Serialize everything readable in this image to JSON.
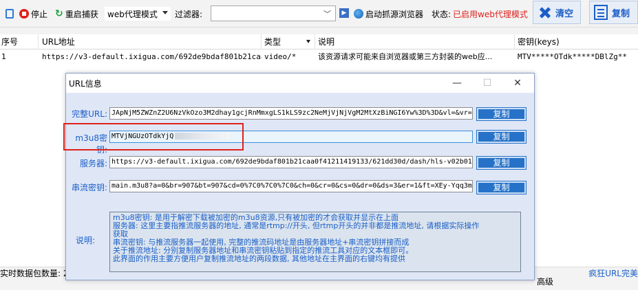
{
  "toolbar": {
    "stop_label": "停止",
    "restart_label": "重启捕获",
    "mode_value": "web代理模式",
    "filter_label": "过滤器:",
    "filter_value": "",
    "launch_label": "启动抓源浏览器",
    "status_label": "状态:",
    "status_value": "已启用web代理模式",
    "clear_label": "清空",
    "copy_label": "复制"
  },
  "grid": {
    "columns": [
      "序号",
      "URL地址",
      "类型",
      "说明",
      "密钥(keys)"
    ],
    "rows": [
      {
        "index": "1",
        "url": "https://v3-default.ixigua.com/692de9bdaf801b21caa...",
        "type": "video/*",
        "desc": "该资源请求可能来自浏览器或第三方封装的web应...",
        "keys": "MTV*****OTdk*****DBlZg**"
      }
    ]
  },
  "statusbar": {
    "packet_label": "实时数据包数量: 2",
    "mid_text": "高级",
    "right_text": "疯狂URL完美"
  },
  "dialog": {
    "title": "URL信息",
    "minimize": "—",
    "maximize": "☐",
    "close": "✕",
    "fields": [
      {
        "label": "完整URL:",
        "value": "JApNjM5ZWZnZ2U6NzVkOzo3M2dhay1gcjRnMmxgLS1kLS9zc2NeMjVjNjVgM2MtXzBiNGI6Yw%3D%3D&vl=&vr=",
        "button": "复制"
      },
      {
        "label": "m3u8密钥:",
        "value": "MTVjNGUzOTdkYjQ",
        "button": "复制"
      },
      {
        "label": "服务器:",
        "value": "https://v3-default.ixigua.com/692de9bdaf801b21caa0f41211419133/621dd30d/dash/hls-v02b01",
        "button": "复制"
      },
      {
        "label": "串流密钥:",
        "value": "main.m3u8?a=0&br=907&bt=907&cd=0%7C0%7C0%7C0&ch=0&cr=0&cs=0&dr=0&ds=3&er=1&ft=XEy-Yqq3m",
        "button": "复制"
      }
    ],
    "desc_label": "说明:",
    "desc_lines": [
      "m3u8密钥: 是用于解密下载被加密的m3u8资源,只有被加密的才会获取并显示在上面",
      "服务器: 这里主要指推流服务器的地址, 通常是rtmp://开头, 但rtmp开头的并非都是推流地址, 请根据实际操作",
      "获取",
      "串流密钥: 与推流服务器一起使用, 完整的推流码地址是由服务器地址+串流密钥拼接而成",
      "关于推流地址: 分别复制服务器地址和串流密钥粘贴到指定的推流工具对应的文本框即可。",
      "此界面的作用主要方便用户复制推流地址的两段数据, 其他地址在主界面的右键均有提供"
    ]
  },
  "colors": {
    "accent": "#1a5ec8",
    "status_red": "#e0201c",
    "dialog_bg": "#dfe7f7"
  }
}
